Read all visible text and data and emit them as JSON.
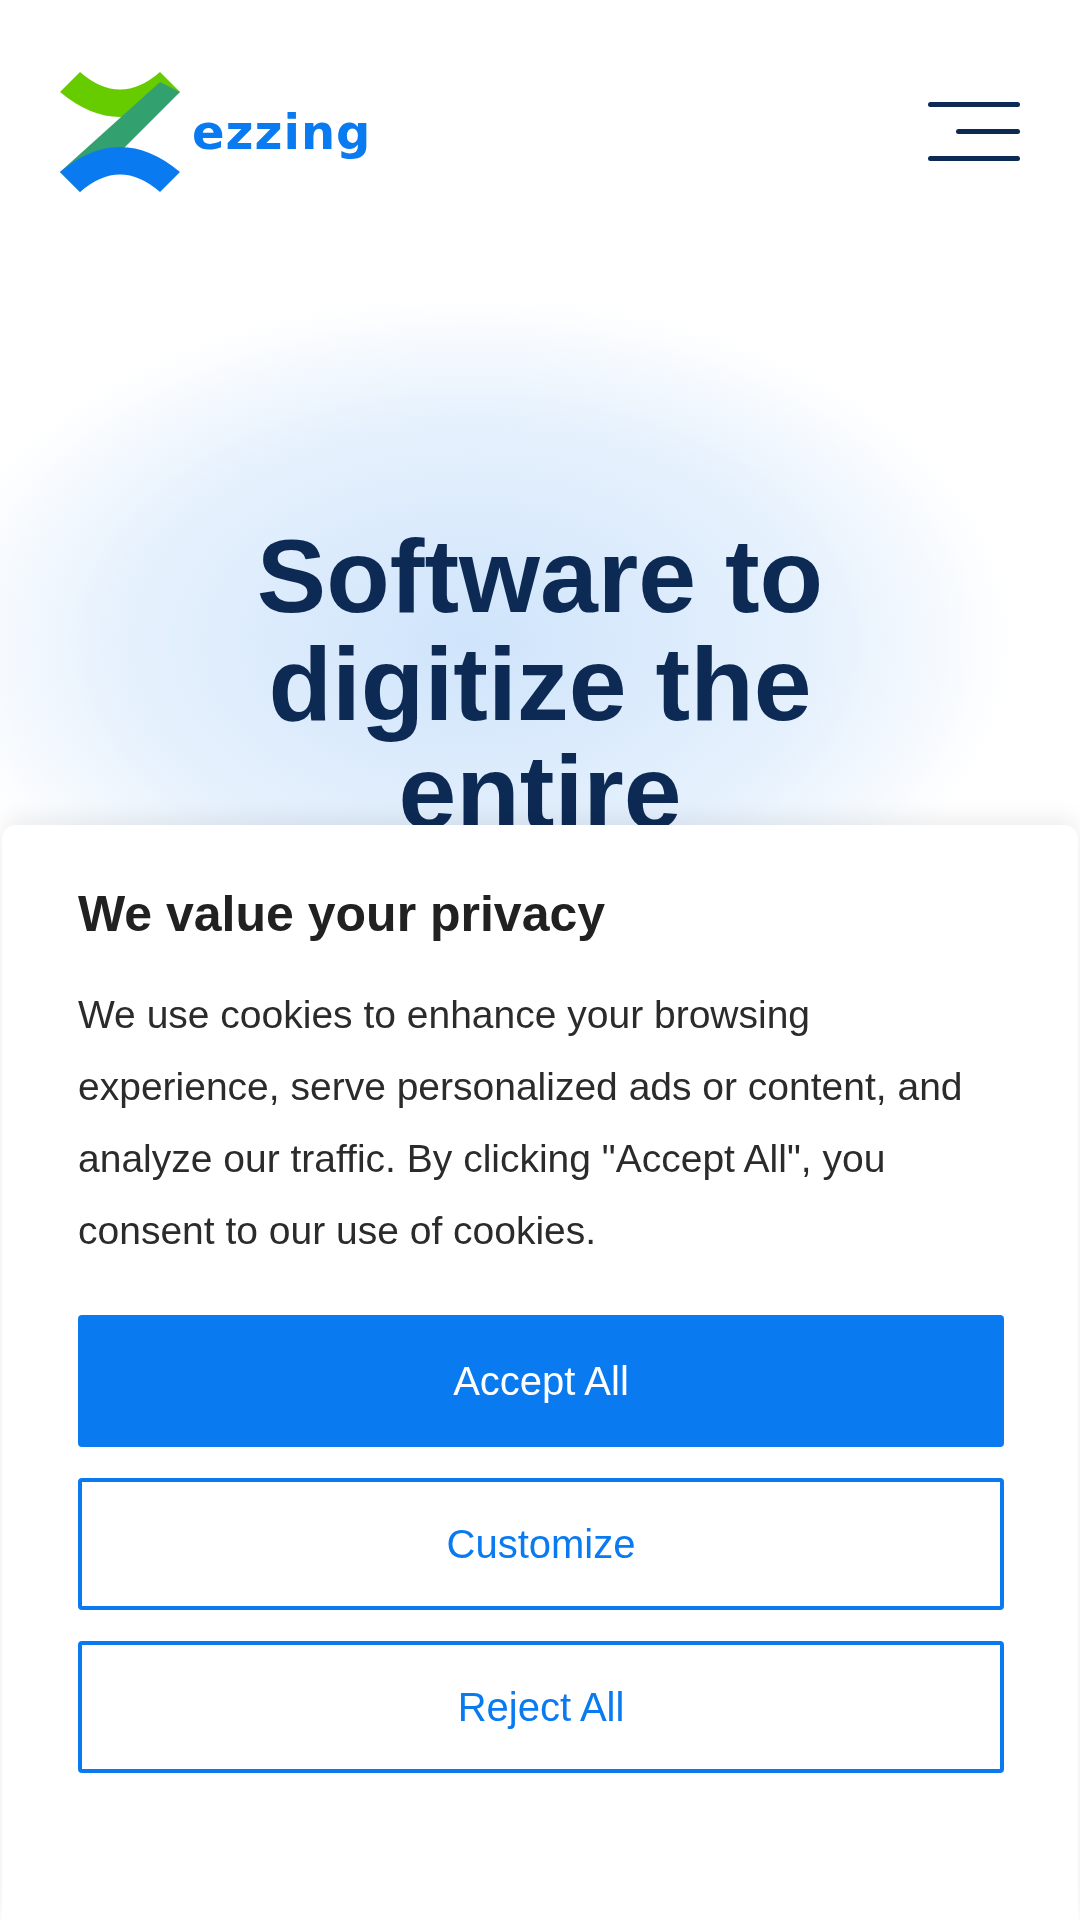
{
  "header": {
    "logo_text": "ezzing"
  },
  "hero": {
    "heading": "Software to digitize the entire"
  },
  "cookie_banner": {
    "title": "We value your privacy",
    "text": "We use cookies to enhance your browsing experience, serve personalized ads or content, and analyze our traffic. By clicking \"Accept All\", you consent to our use of cookies.",
    "buttons": [
      {
        "label": "Accept All",
        "kind": "primary"
      },
      {
        "label": "Customize",
        "kind": "outline"
      },
      {
        "label": "Reject All",
        "kind": "outline"
      }
    ]
  }
}
